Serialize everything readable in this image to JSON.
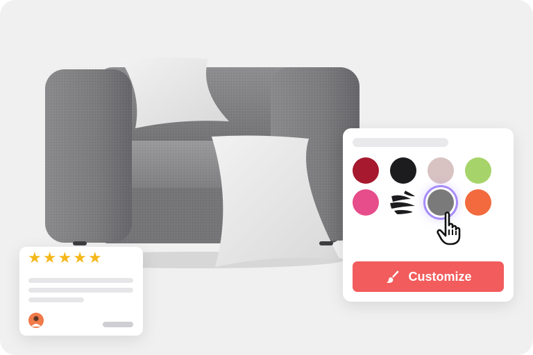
{
  "customize_button": {
    "label": "Customize"
  },
  "palette": {
    "swatches": [
      {
        "name": "burgundy",
        "color": "#a6192e"
      },
      {
        "name": "black",
        "color": "#1c1c1e"
      },
      {
        "name": "blush",
        "color": "#d8c2c2"
      },
      {
        "name": "lime",
        "color": "#a6d46a"
      },
      {
        "name": "pink",
        "color": "#e64d8a"
      },
      {
        "name": "zebra",
        "color": "#222222"
      },
      {
        "name": "gray-fabric",
        "color": "#7a7a7a",
        "selected": true
      },
      {
        "name": "orange",
        "color": "#f26a3d"
      }
    ]
  },
  "review": {
    "rating": 5,
    "max": 5
  },
  "colors": {
    "accent": "#f25c5c",
    "star": "#f5b81c",
    "selection": "#a78bfa"
  },
  "icons": [
    "paintbrush-icon",
    "pointer-hand-icon",
    "star-icon",
    "avatar"
  ]
}
